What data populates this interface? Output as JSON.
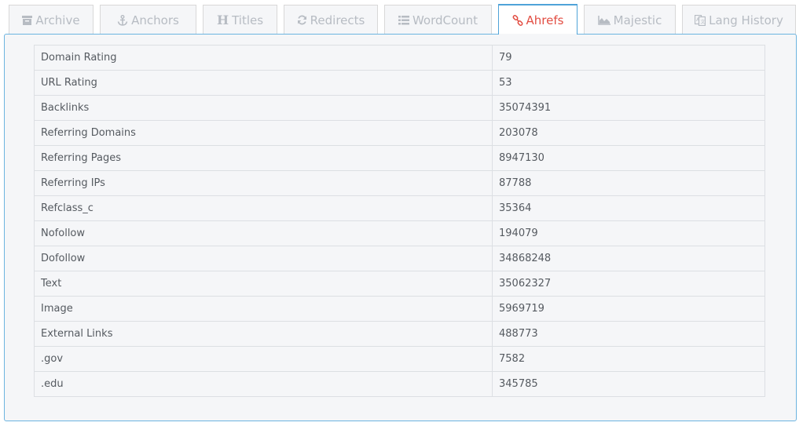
{
  "tabs": [
    {
      "label": "Archive",
      "icon": "archive-icon",
      "active": false
    },
    {
      "label": "Anchors",
      "icon": "anchor-icon",
      "active": false
    },
    {
      "label": "Titles",
      "icon": "heading-icon",
      "active": false
    },
    {
      "label": "Redirects",
      "icon": "refresh-icon",
      "active": false
    },
    {
      "label": "WordCount",
      "icon": "list-icon",
      "active": false
    },
    {
      "label": "Ahrefs",
      "icon": "link-icon",
      "active": true
    },
    {
      "label": "Majestic",
      "icon": "area-chart-icon",
      "active": false
    },
    {
      "label": "Lang History",
      "icon": "language-icon",
      "active": false
    }
  ],
  "metrics": [
    {
      "label": "Domain Rating",
      "value": "79"
    },
    {
      "label": "URL Rating",
      "value": "53"
    },
    {
      "label": "Backlinks",
      "value": "35074391"
    },
    {
      "label": "Referring Domains",
      "value": "203078"
    },
    {
      "label": "Referring Pages",
      "value": "8947130"
    },
    {
      "label": "Referring IPs",
      "value": "87788"
    },
    {
      "label": "Refclass_c",
      "value": "35364"
    },
    {
      "label": "Nofollow",
      "value": "194079"
    },
    {
      "label": "Dofollow",
      "value": "34868248"
    },
    {
      "label": "Text",
      "value": "35062327"
    },
    {
      "label": "Image",
      "value": "5969719"
    },
    {
      "label": "External Links",
      "value": "488773"
    },
    {
      "label": ".gov",
      "value": "7582"
    },
    {
      "label": ".edu",
      "value": "345785"
    }
  ],
  "colors": {
    "active_tab_text": "#e24e43",
    "accent_border": "#4fa3d8",
    "inactive_tab_text": "#b7bcc3"
  }
}
